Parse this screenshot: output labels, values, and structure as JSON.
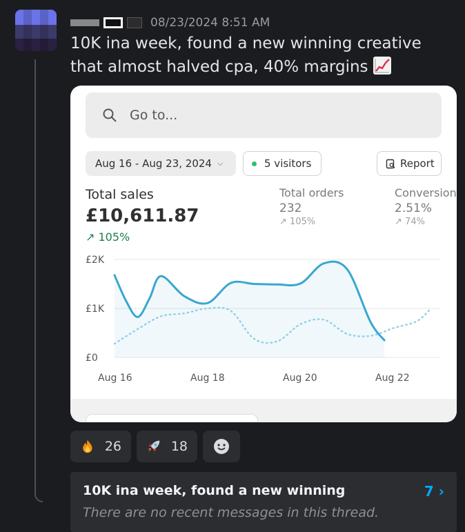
{
  "message": {
    "timestamp": "08/23/2024 8:51 AM",
    "text": "10K ina week, found a new winning creative that almost halved cpa, 40% margins",
    "emoji": "chart-increasing-icon"
  },
  "card": {
    "search_placeholder": "Go to...",
    "date_range": "Aug 16 - Aug 23, 2024",
    "visitors": "5 visitors",
    "report": "Report",
    "total_sales": {
      "label": "Total sales",
      "value": "£10,611.87",
      "change": "105%"
    },
    "total_orders": {
      "label": "Total orders",
      "value": "232",
      "change": "105%"
    },
    "conversion": {
      "label": "Conversion",
      "value": "2.51%",
      "change": "74%"
    }
  },
  "chart_data": {
    "type": "line",
    "y_ticks": [
      "£2K",
      "£1K",
      "£0"
    ],
    "x_ticks": [
      "Aug 16",
      "Aug 18",
      "Aug 20",
      "Aug 22"
    ],
    "ylim": [
      0,
      2000
    ],
    "series": [
      {
        "style": "solid",
        "color": "#3aa6cf",
        "points": [
          [
            0,
            1680
          ],
          [
            0.25,
            1150
          ],
          [
            0.5,
            825
          ],
          [
            0.75,
            1200
          ],
          [
            1,
            1660
          ],
          [
            1.5,
            1250
          ],
          [
            2,
            1110
          ],
          [
            2.5,
            1520
          ],
          [
            3,
            1500
          ],
          [
            3.5,
            1490
          ],
          [
            4,
            1510
          ],
          [
            4.5,
            1920
          ],
          [
            5,
            1800
          ],
          [
            5.5,
            730
          ],
          [
            5.8,
            350
          ]
        ]
      },
      {
        "style": "dotted",
        "color": "#8fd0e6",
        "points": [
          [
            0,
            280
          ],
          [
            0.5,
            580
          ],
          [
            1,
            840
          ],
          [
            1.5,
            900
          ],
          [
            2,
            1000
          ],
          [
            2.5,
            950
          ],
          [
            3,
            380
          ],
          [
            3.5,
            330
          ],
          [
            4,
            680
          ],
          [
            4.5,
            770
          ],
          [
            5,
            480
          ],
          [
            5.5,
            440
          ],
          [
            6,
            600
          ],
          [
            6.5,
            740
          ],
          [
            6.8,
            1000
          ]
        ]
      }
    ]
  },
  "reactions": [
    {
      "emoji": "fire-icon",
      "count": "26"
    },
    {
      "emoji": "rocket-icon",
      "count": "18"
    }
  ],
  "thread": {
    "title": "10K ina week, found a new winning",
    "subtitle": "There are no recent messages in this thread.",
    "count": "7 ›"
  }
}
